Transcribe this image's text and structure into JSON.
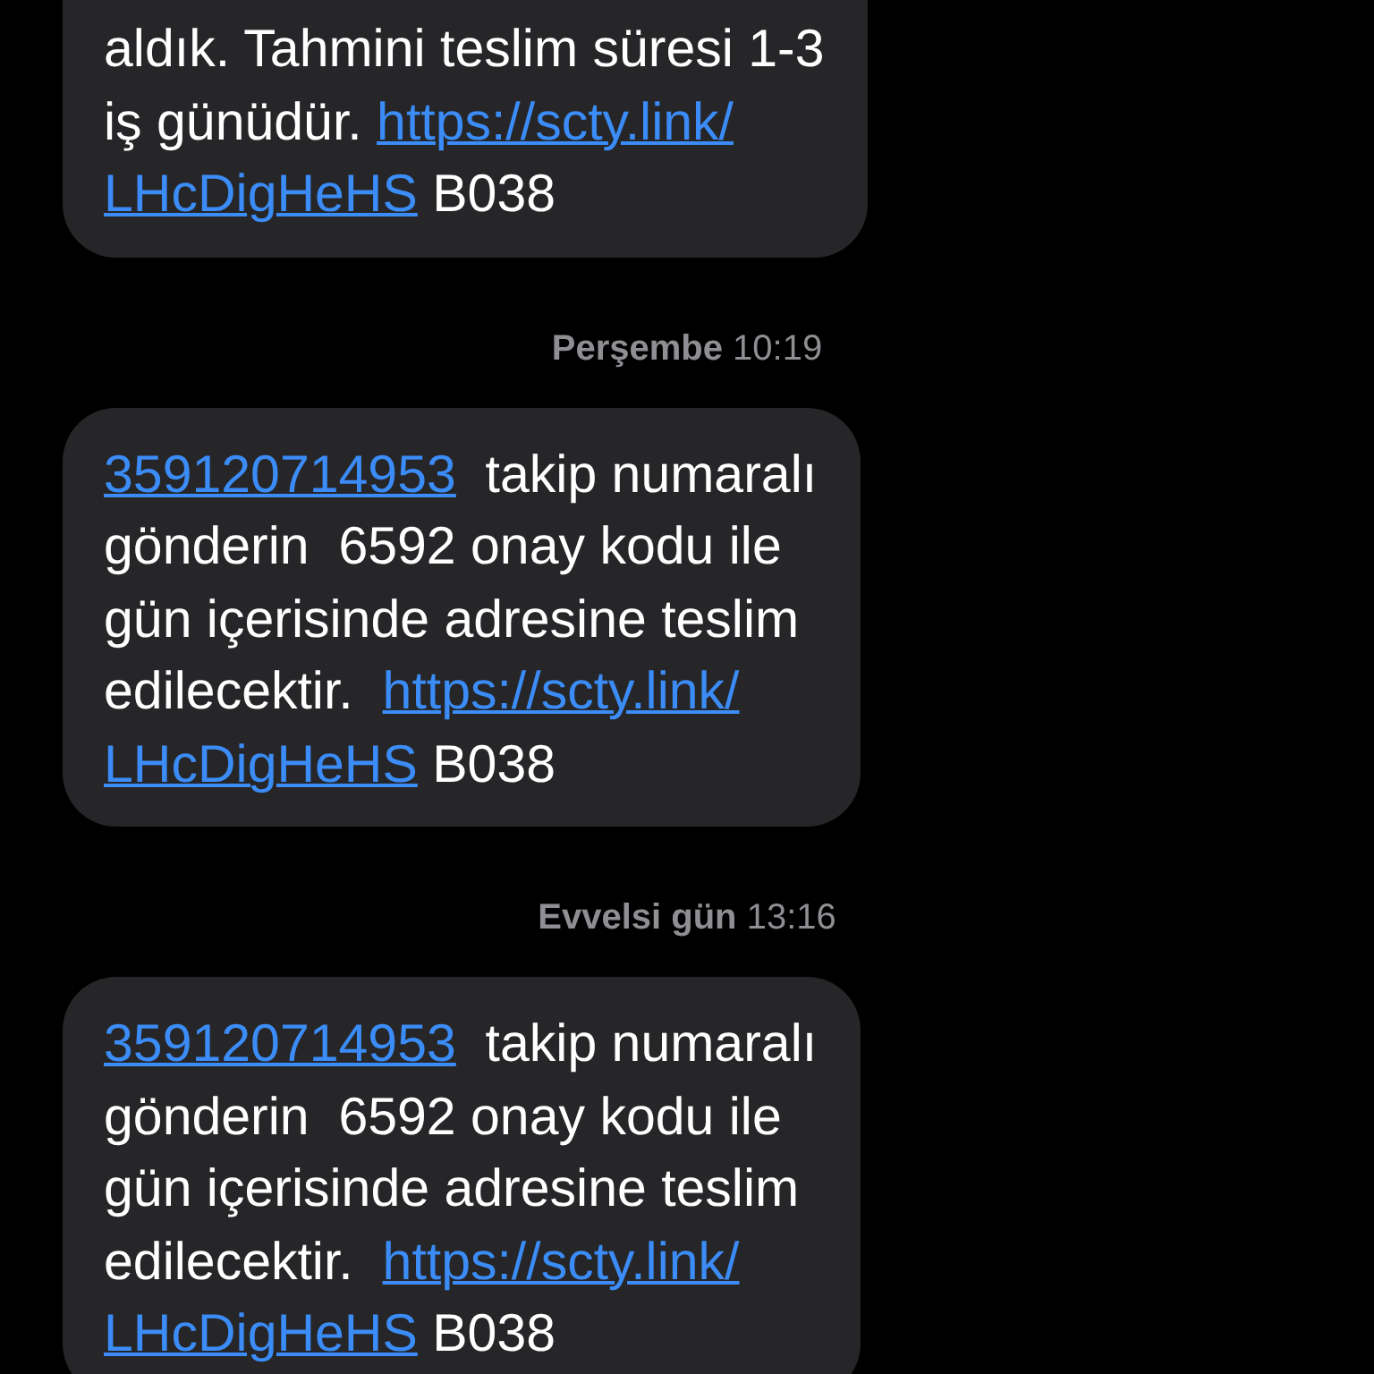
{
  "thread": [
    {
      "kind": "message",
      "cut_top": true,
      "lines": [
        [
          {
            "kind": "text",
            "text": "aldık. Tahmini teslim süresi 1-3"
          }
        ],
        [
          {
            "kind": "text",
            "text": "iş günüdür. "
          },
          {
            "kind": "link",
            "text": "https://scty.link/"
          }
        ],
        [
          {
            "kind": "link",
            "text": "LHcDigHeHS"
          },
          {
            "kind": "text",
            "text": " B038"
          }
        ]
      ]
    },
    {
      "kind": "timestamp",
      "text": "**Perşembe** 10:19"
    },
    {
      "kind": "message",
      "cut_top": false,
      "lines": [
        [
          {
            "kind": "link",
            "text": "359120714953"
          },
          {
            "kind": "text",
            "text": "  takip numaralı"
          }
        ],
        [
          {
            "kind": "text",
            "text": "gönderin  6592 onay kodu ile"
          }
        ],
        [
          {
            "kind": "text",
            "text": "gün içerisinde adresine teslim"
          }
        ],
        [
          {
            "kind": "text",
            "text": "edilecektir.  "
          },
          {
            "kind": "link",
            "text": "https://scty.link/"
          }
        ],
        [
          {
            "kind": "link",
            "text": "LHcDigHeHS"
          },
          {
            "kind": "text",
            "text": " B038"
          }
        ]
      ]
    },
    {
      "kind": "timestamp",
      "text": "**Evvelsi gün** 13:16"
    },
    {
      "kind": "message",
      "cut_top": false,
      "lines": [
        [
          {
            "kind": "link",
            "text": "359120714953"
          },
          {
            "kind": "text",
            "text": "  takip numaralı"
          }
        ],
        [
          {
            "kind": "text",
            "text": "gönderin  6592 onay kodu ile"
          }
        ],
        [
          {
            "kind": "text",
            "text": "gün içerisinde adresine teslim"
          }
        ],
        [
          {
            "kind": "text",
            "text": "edilecektir.  "
          },
          {
            "kind": "link",
            "text": "https://scty.link/"
          }
        ],
        [
          {
            "kind": "link",
            "text": "LHcDigHeHS"
          },
          {
            "kind": "text",
            "text": " B038"
          }
        ]
      ]
    }
  ]
}
